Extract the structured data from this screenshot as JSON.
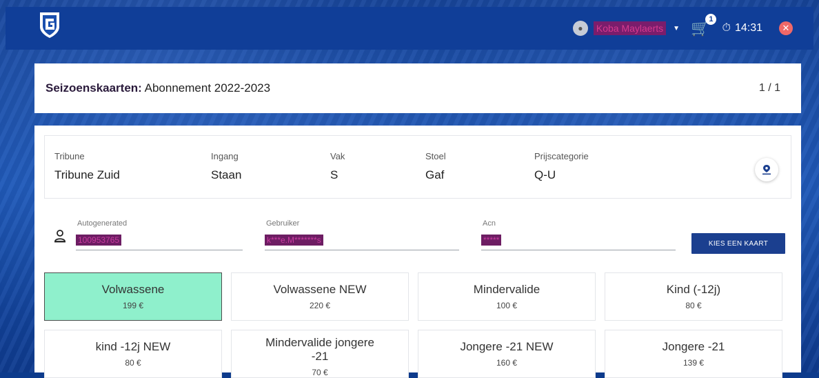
{
  "header": {
    "user_name": "Koba Maylaerts",
    "cart_count": "1",
    "timer": "14:31"
  },
  "title": {
    "label": "Seizoenskaarten:",
    "value": "Abonnement 2022-2023",
    "pager": "1 / 1"
  },
  "seat_info": [
    {
      "label": "Tribune",
      "value": "Tribune Zuid"
    },
    {
      "label": "Ingang",
      "value": "Staan"
    },
    {
      "label": "Vak",
      "value": "S"
    },
    {
      "label": "Stoel",
      "value": "Gaf"
    },
    {
      "label": "Prijscategorie",
      "value": "Q-U"
    }
  ],
  "fields": [
    {
      "label": "Autogenerated",
      "value": "100953765"
    },
    {
      "label": "Gebruiker",
      "value": "k***e.M*******s"
    },
    {
      "label": "Acn",
      "value": "*****"
    }
  ],
  "kies_button": "KIES EEN KAART",
  "prices": [
    {
      "name": "Volwassene",
      "price": "199 €",
      "selected": true
    },
    {
      "name": "Volwassene NEW",
      "price": "220 €"
    },
    {
      "name": "Mindervalide",
      "price": "100 €"
    },
    {
      "name": "Kind (-12j)",
      "price": "80 €"
    },
    {
      "name": "kind -12j NEW",
      "price": "80 €"
    },
    {
      "name": "Mindervalide jongere -21",
      "price": "70 €"
    },
    {
      "name": "Jongere -21 NEW",
      "price": "160 €"
    },
    {
      "name": "Jongere -21",
      "price": "139 €"
    }
  ],
  "colors": {
    "brand_blue": "#103e98",
    "selected_green": "#8ff0cc",
    "close_red": "#f06868"
  },
  "icons": [
    "genk-logo",
    "user-icon",
    "caret-down-icon",
    "cart-icon",
    "stopwatch-icon",
    "close-icon",
    "location-pin-icon",
    "person-icon"
  ]
}
